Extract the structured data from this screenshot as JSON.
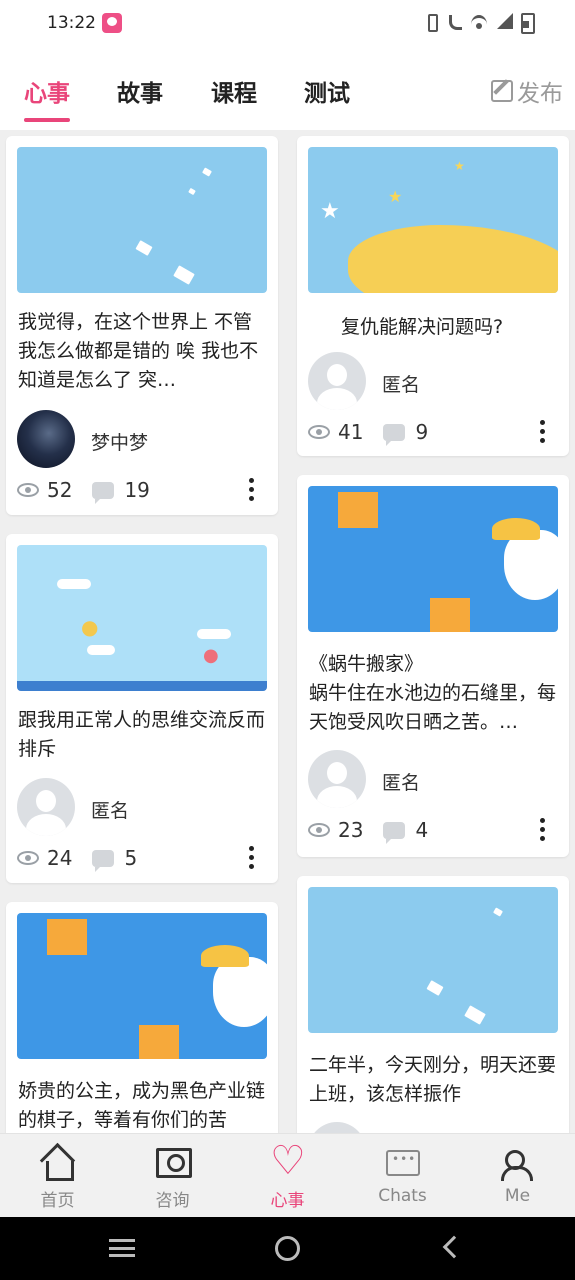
{
  "status_bar": {
    "time": "13:22"
  },
  "tabs": [
    {
      "label": "心事",
      "active": true
    },
    {
      "label": "故事",
      "active": false
    },
    {
      "label": "课程",
      "active": false
    },
    {
      "label": "测试",
      "active": false
    }
  ],
  "publish_label": "发布",
  "accent_color": "#e9457a",
  "cards": [
    {
      "text": "我觉得，在这个世界上  不管我怎么做都是错的    唉  我也不知道是怎么了    突…",
      "author": "梦中梦",
      "views": "52",
      "comments": "19"
    },
    {
      "text": "复仇能解决问题吗?",
      "author": "匿名",
      "views": "41",
      "comments": "9"
    },
    {
      "text": "跟我用正常人的思维交流反而排斥",
      "author": "匿名",
      "views": "24",
      "comments": "5"
    },
    {
      "text": "《蜗牛搬家》\n蜗牛住在水池边的石缝里，每天饱受风吹日晒之苦。…",
      "author": "匿名",
      "views": "23",
      "comments": "4"
    },
    {
      "text": "娇贵的公主，成为黑色产业链的棋子，等着有你们的苦"
    },
    {
      "text": "二年半，今天刚分，明天还要上班，该怎样振作"
    }
  ],
  "bottom_nav": [
    {
      "label": "首页",
      "icon": "home-icon",
      "active": false
    },
    {
      "label": "咨询",
      "icon": "consult-icon",
      "active": false
    },
    {
      "label": "心事",
      "icon": "heart-icon",
      "active": true
    },
    {
      "label": "Chats",
      "icon": "chat-icon",
      "active": false
    },
    {
      "label": "Me",
      "icon": "me-icon",
      "active": false
    }
  ]
}
